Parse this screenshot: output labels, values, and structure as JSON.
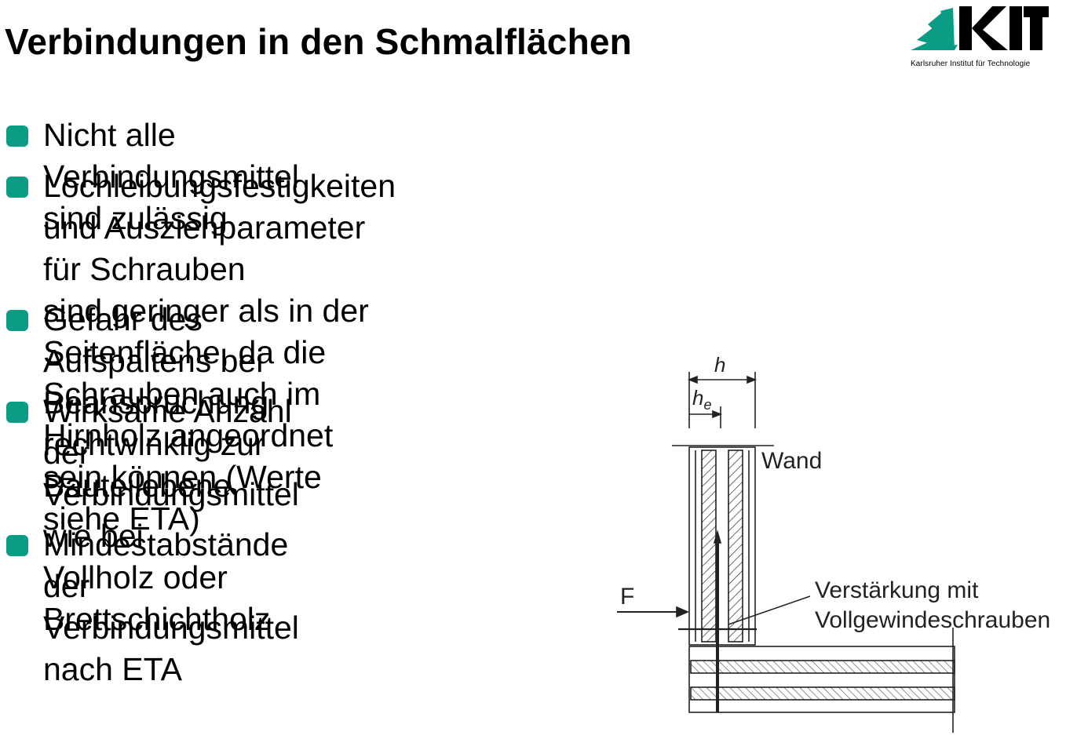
{
  "slide": {
    "title": "Verbindungen in den Schmalflächen",
    "accent_color": "#0b9c86"
  },
  "logo": {
    "name": "KIT",
    "subtitle": "Karlsruher Institut für Technologie",
    "color": "#0b9c86"
  },
  "bullets": [
    {
      "text": "Nicht alle Verbindungsmittel sind zulässig"
    },
    {
      "text": "Lochleibungsfestigkeiten und Ausziehparameter für Schrauben\nsind geringer als in der Seitenfläche, da die Schrauben auch im\nHirnholz angeordnet sein können (Werte siehe ETA)"
    },
    {
      "text": "Gefahr des Aufspaltens bei Beanspruchung rechtwinklig zur\nBauteilebene"
    },
    {
      "text": "Wirksame Anzahl der\nVerbindungsmittel wie bei\nVollholz oder Brettschichtholz"
    },
    {
      "text": "Mindestabstände der\nVerbindungsmittel nach ETA"
    }
  ],
  "figure": {
    "label_h": "h",
    "label_he_main": "h",
    "label_he_sub": "e",
    "label_wall": "Wand",
    "label_force": "F",
    "label_reinforcement_1": "Verstärkung mit",
    "label_reinforcement_2": "Vollgewindeschrauben"
  }
}
